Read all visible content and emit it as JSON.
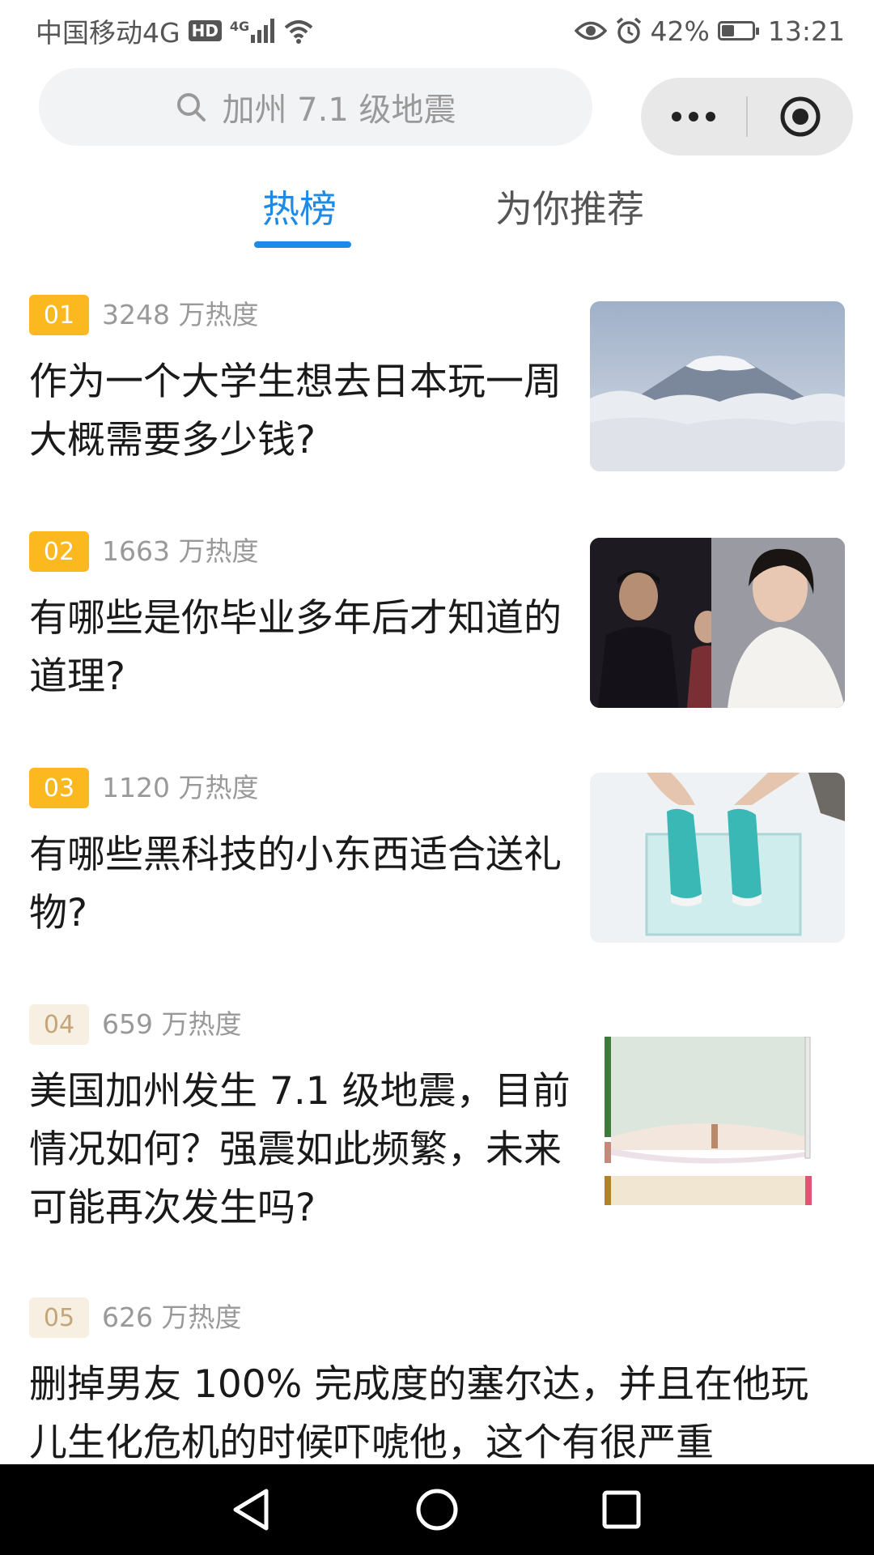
{
  "status_bar": {
    "carrier": "中国移动4G",
    "hd_badge": "HD",
    "network": "4G",
    "battery_percent": "42%",
    "battery_level": 0.42,
    "time": "13:21"
  },
  "search": {
    "placeholder": "加州 7.1 级地震",
    "icon": "search-icon"
  },
  "capsule": {
    "more_icon": "more-dots-icon",
    "close_icon": "target-circle-icon"
  },
  "tabs": [
    {
      "label": "热榜",
      "active": true
    },
    {
      "label": "为你推荐",
      "active": false
    }
  ],
  "accent_color": "#1f8ae6",
  "rank_hot_color": "#fbb91f",
  "hot_list": [
    {
      "rank": "01",
      "heat": "3248 万热度",
      "title": "作为一个大学生想去日本玩一周大概需要多少钱?",
      "thumb": "mount-fuji-image"
    },
    {
      "rank": "02",
      "heat": "1663 万热度",
      "title": "有哪些是你毕业多年后才知道的道理?",
      "thumb": "drama-still-image"
    },
    {
      "rank": "03",
      "heat": "1120 万热度",
      "title": "有哪些黑科技的小东西适合送礼物?",
      "thumb": "sneakers-water-image"
    },
    {
      "rank": "04",
      "heat": "659 万热度",
      "title": "美国加州发生 7.1 级地震，目前情况如何？强震如此频繁，未来可能再次发生吗?",
      "thumb": "sankey-diagram-image"
    },
    {
      "rank": "05",
      "heat": "626 万热度",
      "title": "删掉男友 100% 完成度的塞尔达，并且在他玩儿生化危机的时候吓唬他，这个有很严重",
      "thumb": ""
    }
  ],
  "nav_bar": {
    "back_icon": "back-triangle-icon",
    "home_icon": "home-circle-icon",
    "recents_icon": "recents-square-icon"
  }
}
